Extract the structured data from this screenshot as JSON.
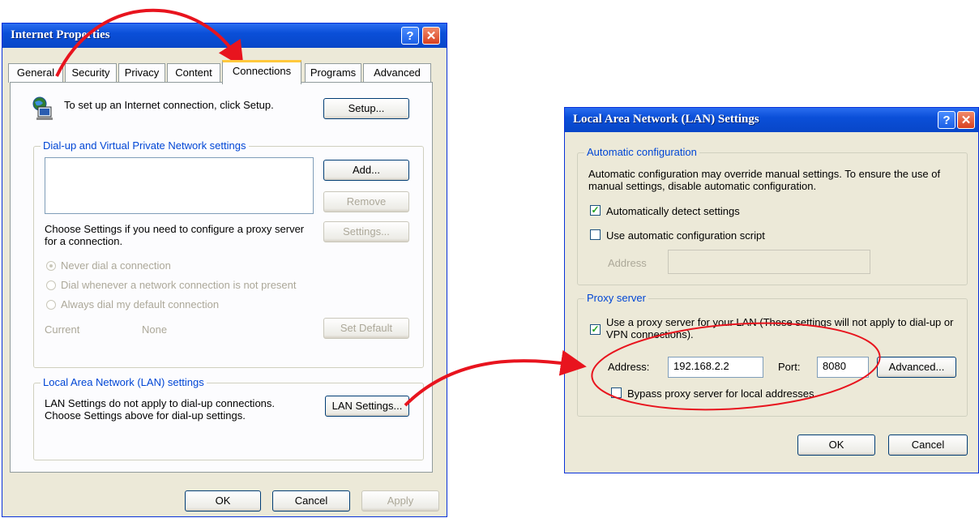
{
  "internet_properties": {
    "title": "Internet Properties",
    "tabs": [
      "General",
      "Security",
      "Privacy",
      "Content",
      "Connections",
      "Programs",
      "Advanced"
    ],
    "active_tab": "Connections",
    "setup_text": "To set up an Internet connection, click Setup.",
    "setup_button": "Setup...",
    "dialup_group": "Dial-up and Virtual Private Network settings",
    "add_button": "Add...",
    "remove_button": "Remove",
    "settings_text": "Choose Settings if you need to configure a proxy server for a connection.",
    "settings_button": "Settings...",
    "radio_never": "Never dial a connection",
    "radio_whenever": "Dial whenever a network connection is not present",
    "radio_always": "Always dial my default connection",
    "current_label": "Current",
    "current_value": "None",
    "set_default_button": "Set Default",
    "lan_group": "Local Area Network (LAN) settings",
    "lan_text": "LAN Settings do not apply to dial-up connections. Choose Settings above for dial-up settings.",
    "lan_button": "LAN Settings...",
    "ok_button": "OK",
    "cancel_button": "Cancel",
    "apply_button": "Apply"
  },
  "lan_settings": {
    "title": "Local Area Network (LAN) Settings",
    "auto_group": "Automatic configuration",
    "auto_text": "Automatic configuration may override manual settings.  To ensure the use of manual settings, disable automatic configuration.",
    "auto_detect_label": "Automatically detect settings",
    "auto_detect_checked": true,
    "auto_script_label": "Use automatic configuration script",
    "auto_script_checked": false,
    "address_label": "Address",
    "address_value": "",
    "proxy_group": "Proxy server",
    "use_proxy_label": "Use a proxy server for your LAN (These settings will not apply to dial-up or VPN connections).",
    "use_proxy_checked": true,
    "proxy_address_label": "Address:",
    "proxy_address_value": "192.168.2.2",
    "port_label": "Port:",
    "port_value": "8080",
    "advanced_button": "Advanced...",
    "bypass_label": "Bypass proxy server for local addresses",
    "bypass_checked": false,
    "ok_button": "OK",
    "cancel_button": "Cancel"
  },
  "colors": {
    "titlebar": "#0a4fd8",
    "dialog_face": "#ece9d8",
    "group_label": "#0046d5",
    "annotation": "#e8141e"
  },
  "icons": [
    "help-icon",
    "close-icon",
    "network-globe-icon"
  ]
}
